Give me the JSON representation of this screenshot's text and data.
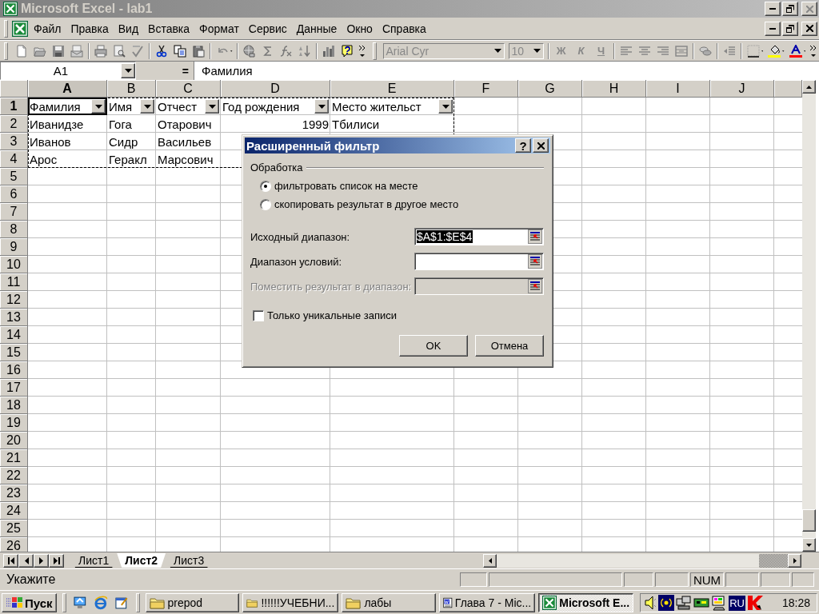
{
  "window": {
    "title": "Microsoft Excel - lab1"
  },
  "menu": [
    {
      "label": "Файл"
    },
    {
      "label": "Правка"
    },
    {
      "label": "Вид"
    },
    {
      "label": "Вставка"
    },
    {
      "label": "Формат"
    },
    {
      "label": "Сервис"
    },
    {
      "label": "Данные"
    },
    {
      "label": "Окно"
    },
    {
      "label": "Справка"
    }
  ],
  "toolbar": {
    "font": "Arial Cyr",
    "size": "10",
    "disabled": true,
    "format_buttons": [
      "Ж",
      "К",
      "Ч"
    ]
  },
  "formula_bar": {
    "name_box": "A1",
    "equals": "=",
    "content": "Фамилия"
  },
  "sheet": {
    "autofilter": true,
    "marquee": true,
    "columns": [
      {
        "label": "A",
        "selected": true
      },
      {
        "label": "B",
        "selected": false
      },
      {
        "label": "C",
        "selected": false
      },
      {
        "label": "D",
        "selected": false
      },
      {
        "label": "E",
        "selected": false
      },
      {
        "label": "F",
        "selected": false
      },
      {
        "label": "G",
        "selected": false
      },
      {
        "label": "H",
        "selected": false
      },
      {
        "label": "I",
        "selected": false
      },
      {
        "label": "J",
        "selected": false
      }
    ],
    "rows": [
      {
        "label": "1",
        "selected": true,
        "cells": [
          {
            "text": "Фамилия",
            "kind": "text"
          },
          {
            "text": "Имя",
            "kind": "text"
          },
          {
            "text": "Отчест",
            "kind": "text"
          },
          {
            "text": "Год рождения",
            "kind": "text"
          },
          {
            "text": "Место жительст",
            "kind": "text"
          }
        ]
      },
      {
        "label": "2",
        "selected": false,
        "cells": [
          {
            "text": "Иванидзе",
            "kind": "text"
          },
          {
            "text": "Гога",
            "kind": "text"
          },
          {
            "text": "Отарович",
            "kind": "text"
          },
          {
            "text": "1999",
            "kind": "number"
          },
          {
            "text": "Тбилиси",
            "kind": "text"
          }
        ]
      },
      {
        "label": "3",
        "selected": false,
        "cells": [
          {
            "text": "Иванов",
            "kind": "text"
          },
          {
            "text": "Сидр",
            "kind": "text"
          },
          {
            "text": "Васильев",
            "kind": "text"
          }
        ]
      },
      {
        "label": "4",
        "selected": false,
        "cells": [
          {
            "text": "Арос",
            "kind": "text"
          },
          {
            "text": "Геракл",
            "kind": "text"
          },
          {
            "text": "Марсович",
            "kind": "text"
          }
        ]
      },
      {
        "label": "5",
        "selected": false
      },
      {
        "label": "6",
        "selected": false
      },
      {
        "label": "7",
        "selected": false
      },
      {
        "label": "8",
        "selected": false
      },
      {
        "label": "9",
        "selected": false
      },
      {
        "label": "10",
        "selected": false
      },
      {
        "label": "11",
        "selected": false
      },
      {
        "label": "12",
        "selected": false
      },
      {
        "label": "13",
        "selected": false
      },
      {
        "label": "14",
        "selected": false
      },
      {
        "label": "15",
        "selected": false
      },
      {
        "label": "16",
        "selected": false
      },
      {
        "label": "17",
        "selected": false
      },
      {
        "label": "18",
        "selected": false
      },
      {
        "label": "19",
        "selected": false
      },
      {
        "label": "20",
        "selected": false
      },
      {
        "label": "21",
        "selected": false
      },
      {
        "label": "22",
        "selected": false
      },
      {
        "label": "23",
        "selected": false
      },
      {
        "label": "24",
        "selected": false
      },
      {
        "label": "25",
        "selected": false
      },
      {
        "label": "26",
        "selected": false
      }
    ]
  },
  "sheet_tabs": [
    {
      "label": "Лист1",
      "selected": false
    },
    {
      "label": "Лист2",
      "selected": true
    },
    {
      "label": "Лист3",
      "selected": false
    }
  ],
  "status_bar": {
    "message": "Укажите",
    "num_lock": "NUM"
  },
  "dialog": {
    "title": "Расширенный фильтр",
    "help": "?",
    "group": "Обработка",
    "options": [
      {
        "label": "фильтровать список на месте",
        "selected": true
      },
      {
        "label": "скопировать результат в другое место",
        "selected": false
      }
    ],
    "fields": [
      {
        "label": "Исходный диапазон:",
        "value": "$A$1:$E$4",
        "highlighted": true,
        "disabled": false
      },
      {
        "label": "Диапазон условий:",
        "disabled": false
      },
      {
        "label": "Поместить результат в диапазон:",
        "disabled": true
      }
    ],
    "unique": {
      "label": "Только уникальные записи",
      "checked": false
    },
    "buttons": [
      "OK",
      "Отмена"
    ]
  },
  "taskbar": {
    "start": "Пуск",
    "tasks": [
      {
        "label": "prepod",
        "kind": "folder",
        "selected": false
      },
      {
        "label": "!!!!!!УЧЕБНИ...",
        "kind": "folder",
        "selected": false
      },
      {
        "label": "лабы",
        "kind": "folder",
        "selected": false
      },
      {
        "label": "Глава 7 - Mic...",
        "kind": "word",
        "selected": false
      },
      {
        "label": "Microsoft E...",
        "kind": "excel",
        "selected": true
      }
    ],
    "language": "RU",
    "clock": "18:28"
  }
}
